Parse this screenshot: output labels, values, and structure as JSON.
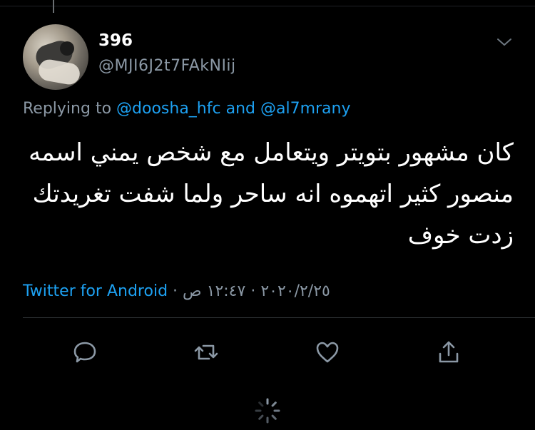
{
  "tweet": {
    "display_name": "396",
    "handle": "@MJI6J2t7FAkNIij",
    "replying_prefix": "Replying to",
    "reply_to": [
      "@doosha_hfc",
      "@al7mrany"
    ],
    "reply_and": "and",
    "text_lines": [
      "كان مشهور بتويتر ويتعامل مع شخص يمني اسمه",
      "منصور كثير اتهموه انه ساحر ولما شفت تغريدتك",
      "زدت خوف"
    ],
    "source": "Twitter for Android",
    "separator": "·",
    "date": "٢٠٢٠/٢/٢٥",
    "time": "١٢:٤٧ ص"
  },
  "icons": {
    "more": "chevron-down-icon",
    "reply": "reply-icon",
    "retweet": "retweet-icon",
    "like": "heart-icon",
    "share": "share-icon",
    "loading": "spinner-icon"
  },
  "colors": {
    "background": "#000000",
    "text": "#ffffff",
    "secondary": "#8b98a5",
    "link": "#1da1f2",
    "divider": "#2f3336"
  }
}
